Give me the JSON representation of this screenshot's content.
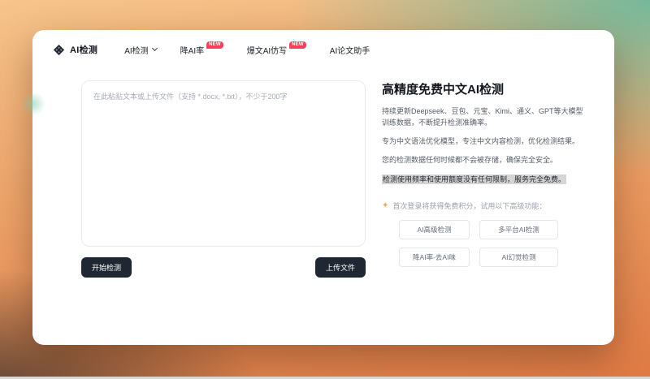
{
  "brand": {
    "title": "AI检测"
  },
  "nav": {
    "items": [
      {
        "label": "AI检测",
        "has_dropdown": true
      },
      {
        "label": "降AI率",
        "badge": "NEW"
      },
      {
        "label": "爆文AI仿写",
        "badge": "NEW"
      },
      {
        "label": "AI论文助手"
      }
    ]
  },
  "editor": {
    "placeholder": "在此粘贴文本或上传文件（支持 *.docx, *.txt），不少于200字",
    "value": "",
    "start_button": "开始检测",
    "upload_button": "上传文件"
  },
  "info": {
    "title": "高精度免费中文AI检测",
    "paragraphs": [
      "持续更新Deepseek、豆包、元宝、Kimi、通义、GPT等大模型训练数据，不断提升检测准确率。",
      "专为中文语法优化模型，专注中文内容检测，优化检测结果。",
      "您的检测数据任何时候都不会被存储，确保完全安全。"
    ],
    "highlight": "检测使用频率和使用额度没有任何限制，服务完全免费。",
    "promo": "首次登录将获得免费积分，试用以下高级功能：",
    "promo_icon": "sparkle-icon",
    "features": [
      "AI高级检测",
      "多平台AI检测",
      "降AI率-去AI味",
      "AI幻觉检测"
    ]
  },
  "colors": {
    "primary_button": "#1f2733",
    "badge_red": "#f4405a",
    "highlight_gray": "#d5d5d5",
    "sparkle_orange": "#f0a84c",
    "bg_teal": "#6fb89c",
    "bg_peach": "#f6c48c",
    "bg_orange": "#e07a44",
    "bg_dark": "#3a322d"
  }
}
